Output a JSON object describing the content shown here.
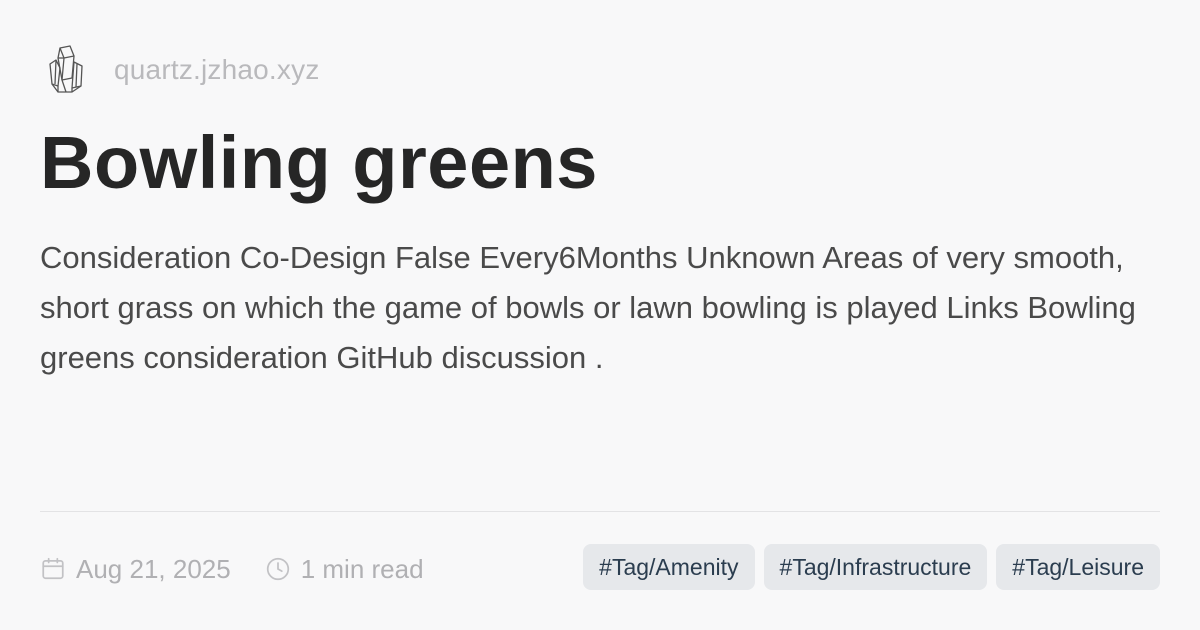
{
  "site": {
    "logo_icon": "crystal-cluster-icon",
    "domain": "quartz.jzhao.xyz"
  },
  "page": {
    "title": "Bowling greens",
    "description": "Consideration Co-Design False Every6Months Unknown Areas of very smooth, short grass on which the game of bowls or lawn bowling is played Links Bowling greens consideration GitHub discussion ."
  },
  "meta": {
    "date_icon": "calendar-icon",
    "date": "Aug 21, 2025",
    "read_icon": "clock-icon",
    "read_time": "1 min read"
  },
  "tags": [
    "#Tag/Amenity",
    "#Tag/Infrastructure",
    "#Tag/Leisure"
  ],
  "colors": {
    "background": "#f8f8f9",
    "title": "#262626",
    "muted": "#b0b0b3",
    "tag_background": "#e6e8eb",
    "tag_text": "#2b3d4f"
  }
}
